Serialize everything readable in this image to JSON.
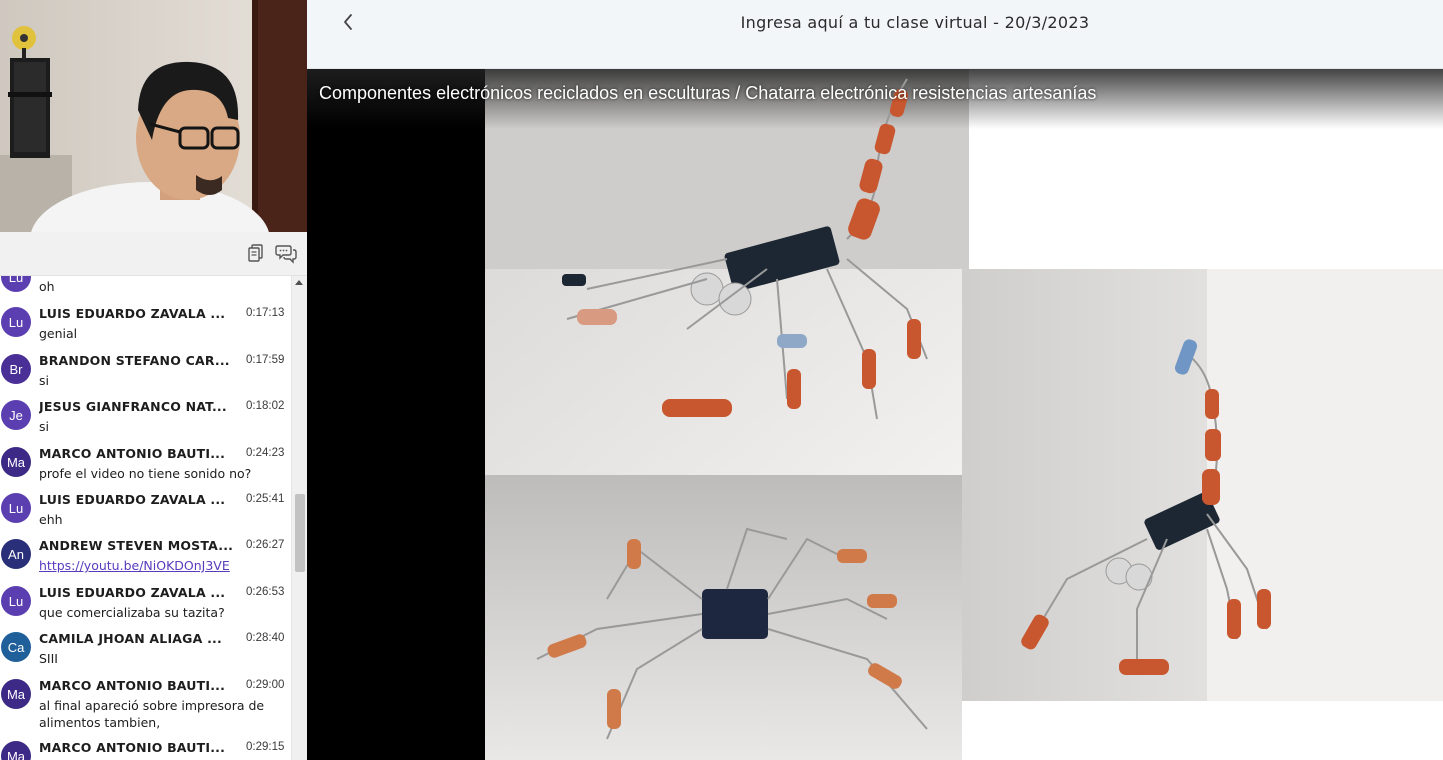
{
  "header": {
    "title": "Ingresa aquí a tu clase virtual - 20/3/2023",
    "back_icon": "chevron-left-icon"
  },
  "video": {
    "title": "Componentes electrónicos reciclados en esculturas / Chatarra electrónica resistencias artesanías"
  },
  "chat": {
    "toolbar_icons": [
      "copy-icon",
      "chat-bubbles-icon"
    ],
    "partial_message": {
      "initials": "Lu",
      "text": "oh"
    },
    "messages": [
      {
        "initials": "Lu",
        "name": "LUIS EDUARDO ZAVALA ...",
        "time": "0:17:13",
        "text": "genial",
        "color": "#5b3fb0"
      },
      {
        "initials": "Br",
        "name": "BRANDON STEFANO CAR...",
        "time": "0:17:59",
        "text": "si",
        "color": "#4a2f96"
      },
      {
        "initials": "Je",
        "name": "JESUS GIANFRANCO NAT...",
        "time": "0:18:02",
        "text": "si",
        "color": "#5b3fb0"
      },
      {
        "initials": "Ma",
        "name": "MARCO ANTONIO BAUTI...",
        "time": "0:24:23",
        "text": "profe el video no tiene sonido no?",
        "color": "#3d2a86"
      },
      {
        "initials": "Lu",
        "name": "LUIS EDUARDO ZAVALA ...",
        "time": "0:25:41",
        "text": "ehh",
        "color": "#5b3fb0"
      },
      {
        "initials": "An",
        "name": "ANDREW STEVEN MOSTA...",
        "time": "0:26:27",
        "text": "https://youtu.be/NiOKDOnJ3VE",
        "link": true,
        "color": "#2a2f7a"
      },
      {
        "initials": "Lu",
        "name": "LUIS EDUARDO ZAVALA ...",
        "time": "0:26:53",
        "text": "que comercializaba su tazita?",
        "color": "#5b3fb0"
      },
      {
        "initials": "Ca",
        "name": "CAMILA JHOAN ALIAGA ...",
        "time": "0:28:40",
        "text": "SIII",
        "color": "#1f5f9a"
      },
      {
        "initials": "Ma",
        "name": "MARCO ANTONIO BAUTI...",
        "time": "0:29:00",
        "text": "al final apareció sobre impresora de alimentos tambien,",
        "color": "#3d2a86"
      },
      {
        "initials": "Ma",
        "name": "MARCO ANTONIO BAUTI...",
        "time": "0:29:15",
        "text": "",
        "color": "#3d2a86"
      }
    ]
  }
}
